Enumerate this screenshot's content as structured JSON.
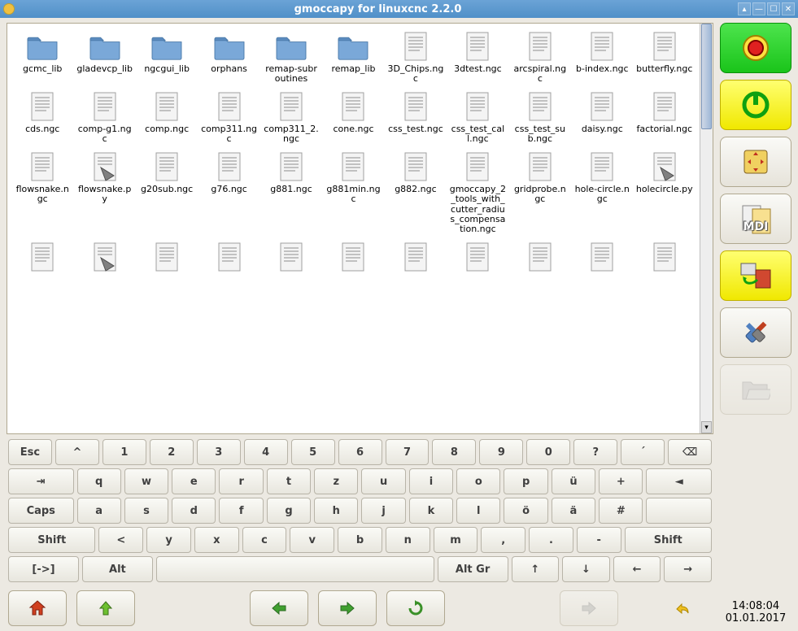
{
  "window": {
    "title": "gmoccapy for linuxcnc  2.2.0"
  },
  "files": [
    {
      "name": "gcmc_lib",
      "type": "folder"
    },
    {
      "name": "gladevcp_lib",
      "type": "folder"
    },
    {
      "name": "ngcgui_lib",
      "type": "folder"
    },
    {
      "name": "orphans",
      "type": "folder"
    },
    {
      "name": "remap-subroutines",
      "type": "folder"
    },
    {
      "name": "remap_lib",
      "type": "folder"
    },
    {
      "name": "3D_Chips.ngc",
      "type": "file"
    },
    {
      "name": "3dtest.ngc",
      "type": "file"
    },
    {
      "name": "arcspiral.ngc",
      "type": "file"
    },
    {
      "name": "b-index.ngc",
      "type": "file"
    },
    {
      "name": "butterfly.ngc",
      "type": "file"
    },
    {
      "name": "cds.ngc",
      "type": "file"
    },
    {
      "name": "comp-g1.ngc",
      "type": "file"
    },
    {
      "name": "comp.ngc",
      "type": "file"
    },
    {
      "name": "comp311.ngc",
      "type": "file"
    },
    {
      "name": "comp311_2.ngc",
      "type": "file"
    },
    {
      "name": "cone.ngc",
      "type": "file"
    },
    {
      "name": "css_test.ngc",
      "type": "file"
    },
    {
      "name": "css_test_call.ngc",
      "type": "file"
    },
    {
      "name": "css_test_sub.ngc",
      "type": "file"
    },
    {
      "name": "daisy.ngc",
      "type": "file"
    },
    {
      "name": "factorial.ngc",
      "type": "file"
    },
    {
      "name": "flowsnake.ngc",
      "type": "file"
    },
    {
      "name": "flowsnake.py",
      "type": "script"
    },
    {
      "name": "g20sub.ngc",
      "type": "file"
    },
    {
      "name": "g76.ngc",
      "type": "file"
    },
    {
      "name": "g881.ngc",
      "type": "file"
    },
    {
      "name": "g881min.ngc",
      "type": "file"
    },
    {
      "name": "g882.ngc",
      "type": "file"
    },
    {
      "name": "gmoccapy_2_tools_with_cutter_radius_compensation.ngc",
      "type": "file"
    },
    {
      "name": "gridprobe.ngc",
      "type": "file"
    },
    {
      "name": "hole-circle.ngc",
      "type": "file"
    },
    {
      "name": "holecircle.py",
      "type": "script"
    },
    {
      "name": "",
      "type": "file"
    },
    {
      "name": "",
      "type": "script"
    },
    {
      "name": "",
      "type": "file"
    },
    {
      "name": "",
      "type": "file"
    },
    {
      "name": "",
      "type": "file"
    },
    {
      "name": "",
      "type": "file"
    },
    {
      "name": "",
      "type": "file"
    },
    {
      "name": "",
      "type": "file"
    },
    {
      "name": "",
      "type": "file"
    },
    {
      "name": "",
      "type": "file"
    },
    {
      "name": "",
      "type": "file"
    }
  ],
  "keyboard": {
    "row1": [
      "Esc",
      "^",
      "1",
      "2",
      "3",
      "4",
      "5",
      "6",
      "7",
      "8",
      "9",
      "0",
      "?",
      "´",
      "⌫"
    ],
    "row2": [
      "⇥",
      "q",
      "w",
      "e",
      "r",
      "t",
      "z",
      "u",
      "i",
      "o",
      "p",
      "ü",
      "+",
      "◄"
    ],
    "row3": [
      "Caps",
      "a",
      "s",
      "d",
      "f",
      "g",
      "h",
      "j",
      "k",
      "l",
      "ö",
      "ä",
      "#",
      ""
    ],
    "row4": [
      "Shift",
      "<",
      "y",
      "x",
      "c",
      "v",
      "b",
      "n",
      "m",
      ",",
      ".",
      "-",
      "Shift"
    ],
    "row5": [
      "[->]",
      "Alt",
      "",
      "Alt Gr",
      "↑",
      "↓",
      "←",
      "→"
    ]
  },
  "side": {
    "estop": "estop-icon",
    "power": "power-icon",
    "jog": "jog-icon",
    "mdi": "MDI",
    "auto": "auto-icon",
    "settings": "settings-icon",
    "folder": "folder-open-icon"
  },
  "clock": {
    "time": "14:08:04",
    "date": "01.01.2017"
  },
  "nav": {
    "home": "home",
    "up": "up",
    "back": "back",
    "forward": "forward",
    "reload": "reload",
    "select": "select",
    "undo": "undo"
  }
}
